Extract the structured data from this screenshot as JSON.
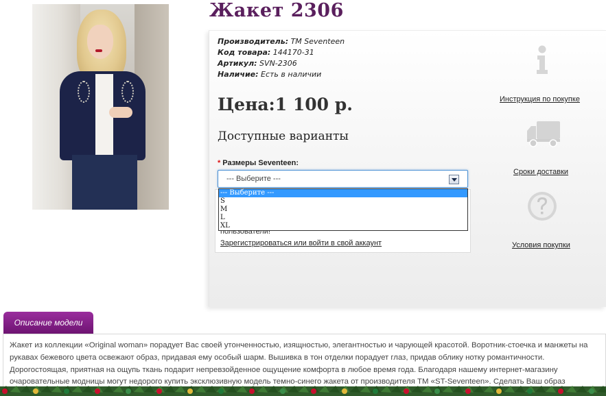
{
  "product": {
    "title": "Жакет 2306",
    "specs": [
      {
        "label": "Производитель:",
        "value": " TM Seventeen"
      },
      {
        "label": "Код товара:",
        "value": " 144170-31"
      },
      {
        "label": "Артикул:",
        "value": " SVN-2306"
      },
      {
        "label": "Наличие:",
        "value": " Есть в наличии"
      }
    ],
    "price": "Цена:1 100 р."
  },
  "variants": {
    "title": "Доступные варианты",
    "size_required_mark": "*",
    "size_label": "Размеры Seventeen:",
    "size_selected": "--- Выберите ---",
    "size_options": [
      "--- Выберите ---",
      "S",
      "M",
      "L",
      "XL"
    ]
  },
  "login": {
    "text": "пользователи!",
    "link": "Зарегистрироваться или войти в свой аккаунт"
  },
  "side": {
    "instruction": "Инструкция по покупке",
    "delivery": "Сроки доставки",
    "terms": "Условия покупки",
    "icons": [
      "info-icon",
      "truck-icon",
      "question-icon"
    ]
  },
  "description": {
    "tab": "Описание модели",
    "text": "Жакет из коллекции «Original woman» порадует Вас своей утонченностью, изящностью, элегантностью и чарующей красотой. Воротник-стоечка и манжеты на рукавах бежевого цвета освежают образ, придавая ему особый шарм. Вышивка в тон отделки порадует глаз, придав облику нотку романтичности. Дорогостоящая, приятная на ощупь ткань подарит непревзойденное ощущение комфорта в любое время года. Благодаря нашему интернет-магазину очаровательные модницы могут недорого купить эксклюзивную модель темно-синего жакета от производителя ТМ «ST-Seventeen». Сделать Ваш образ"
  },
  "colors": {
    "title": "#5a1f5d",
    "tab": "#8a2390",
    "select_border": "#4a8fd3",
    "option_highlight": "#3399ff"
  }
}
